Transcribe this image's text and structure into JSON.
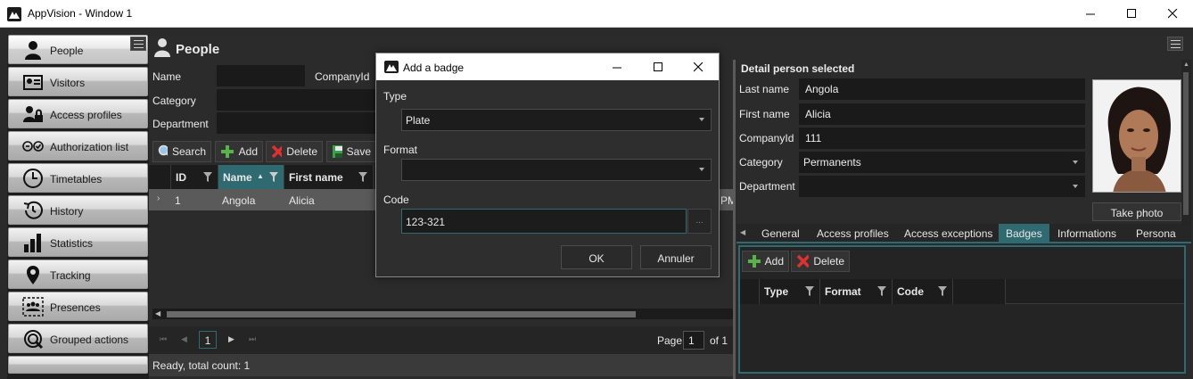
{
  "window": {
    "title": "AppVision - Window 1",
    "buttons": [
      "minimize",
      "maximize",
      "close"
    ]
  },
  "sidebar": {
    "items": [
      {
        "label": "People",
        "icon": "person-icon",
        "active": true
      },
      {
        "label": "Visitors",
        "icon": "visitor-card-icon"
      },
      {
        "label": "Access profiles",
        "icon": "access-profile-icon"
      },
      {
        "label": "Authorization list",
        "icon": "authorization-icon"
      },
      {
        "label": "Timetables",
        "icon": "clock-icon"
      },
      {
        "label": "History",
        "icon": "history-icon"
      },
      {
        "label": "Statistics",
        "icon": "bar-chart-icon"
      },
      {
        "label": "Tracking",
        "icon": "location-pin-icon"
      },
      {
        "label": "Presences",
        "icon": "presences-icon"
      },
      {
        "label": "Grouped actions",
        "icon": "grouped-actions-icon"
      }
    ]
  },
  "people": {
    "title": "People",
    "filters": {
      "name_label": "Name",
      "companyid_label": "CompanyId",
      "category_label": "Category",
      "department_label": "Department"
    },
    "toolbar": {
      "search": "Search",
      "add": "Add",
      "delete": "Delete",
      "save": "Save"
    },
    "grid": {
      "columns": [
        "ID",
        "Name",
        "First name"
      ],
      "rows": [
        {
          "id": "1",
          "name": "Angola",
          "first_name": "Alicia",
          "extra": "PM"
        }
      ]
    },
    "pager": {
      "current": "1",
      "page_label": "Page",
      "page_value": "1",
      "of_label": "of 1"
    },
    "status": "Ready, total count: 1"
  },
  "dialog": {
    "title": "Add a badge",
    "type_label": "Type",
    "type_value": "Plate",
    "format_label": "Format",
    "format_value": "",
    "code_label": "Code",
    "code_value": "123-321",
    "ellipsis": "...",
    "ok": "OK",
    "cancel": "Annuler"
  },
  "detail": {
    "title": "Detail person selected",
    "last_name_label": "Last name",
    "last_name": "Angola",
    "first_name_label": "First name",
    "first_name": "Alicia",
    "companyid_label": "CompanyId",
    "companyid": "111",
    "category_label": "Category",
    "category": "Permanents",
    "department_label": "Department",
    "department": "",
    "take_photo": "Take photo",
    "tabs": [
      "General",
      "Access profiles",
      "Access exceptions",
      "Badges",
      "Informations",
      "Persona"
    ],
    "active_tab": "Badges",
    "badges": {
      "add": "Add",
      "delete": "Delete",
      "columns": [
        "Type",
        "Format",
        "Code"
      ]
    }
  },
  "colors": {
    "accent": "#2e6a70",
    "background": "#2b2b2b",
    "input": "#1a1a1a"
  }
}
